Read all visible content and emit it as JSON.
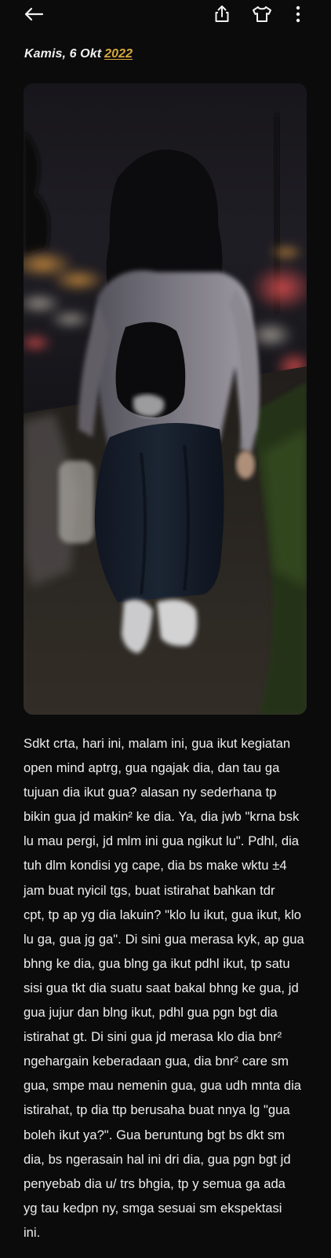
{
  "top_bar": {
    "icons": [
      "back-arrow-icon",
      "share-icon",
      "shirt-icon",
      "more-vertical-icon"
    ]
  },
  "entry": {
    "date_prefix": "Kamis, 6 Okt",
    "date_year": "2022",
    "body_lines": [
      "Sdkt crta, hari ini, malam ini, gua ikut kegiatan",
      "open mind aptrg, gua ngajak dia, dan tau ga",
      "tujuan dia ikut gua? alasan ny sederhana tp",
      "bikin gua jd makin² ke dia. Ya, dia jwb \"krna bsk",
      "lu mau pergi, jd mlm ini gua ngikut lu\". Pdhl, dia",
      "tuh dlm kondisi yg cape, dia bs make wktu ±4",
      "jam buat nyicil tgs, buat istirahat bahkan tdr",
      "cpt, tp ap yg dia lakuin? \"klo lu ikut, gua ikut, klo",
      "lu ga, gua jg ga\". Di sini gua merasa kyk, ap gua",
      "bhng ke dia, gua blng ga ikut pdhl ikut, tp satu",
      "sisi gua tkt dia suatu saat bakal bhng ke gua, jd",
      "gua jujur dan blng ikut, pdhl gua pgn bgt dia",
      "istirahat gt. Di sini gua jd merasa klo dia bnr²",
      "ngehargain keberadaan gua, dia bnr² care sm",
      "gua, smpe mau nemenin gua, gua udh mnta dia",
      "istirahat, tp dia ttp berusaha buat nnya lg \"gua",
      "boleh ikut ya?\". Gua beruntung bgt bs dkt sm",
      "dia, bs ngerasain hal ini dri dia, gua pgn bgt jd",
      "penyebab dia u/ trs bhgia, tp y semua ga ada",
      "yg tau kedpn ny, smga sesuai sm ekspektasi",
      "ini."
    ]
  },
  "colors": {
    "background": "#0b0b0b",
    "text": "#eeeeee",
    "accent_year": "#d6a73a"
  }
}
